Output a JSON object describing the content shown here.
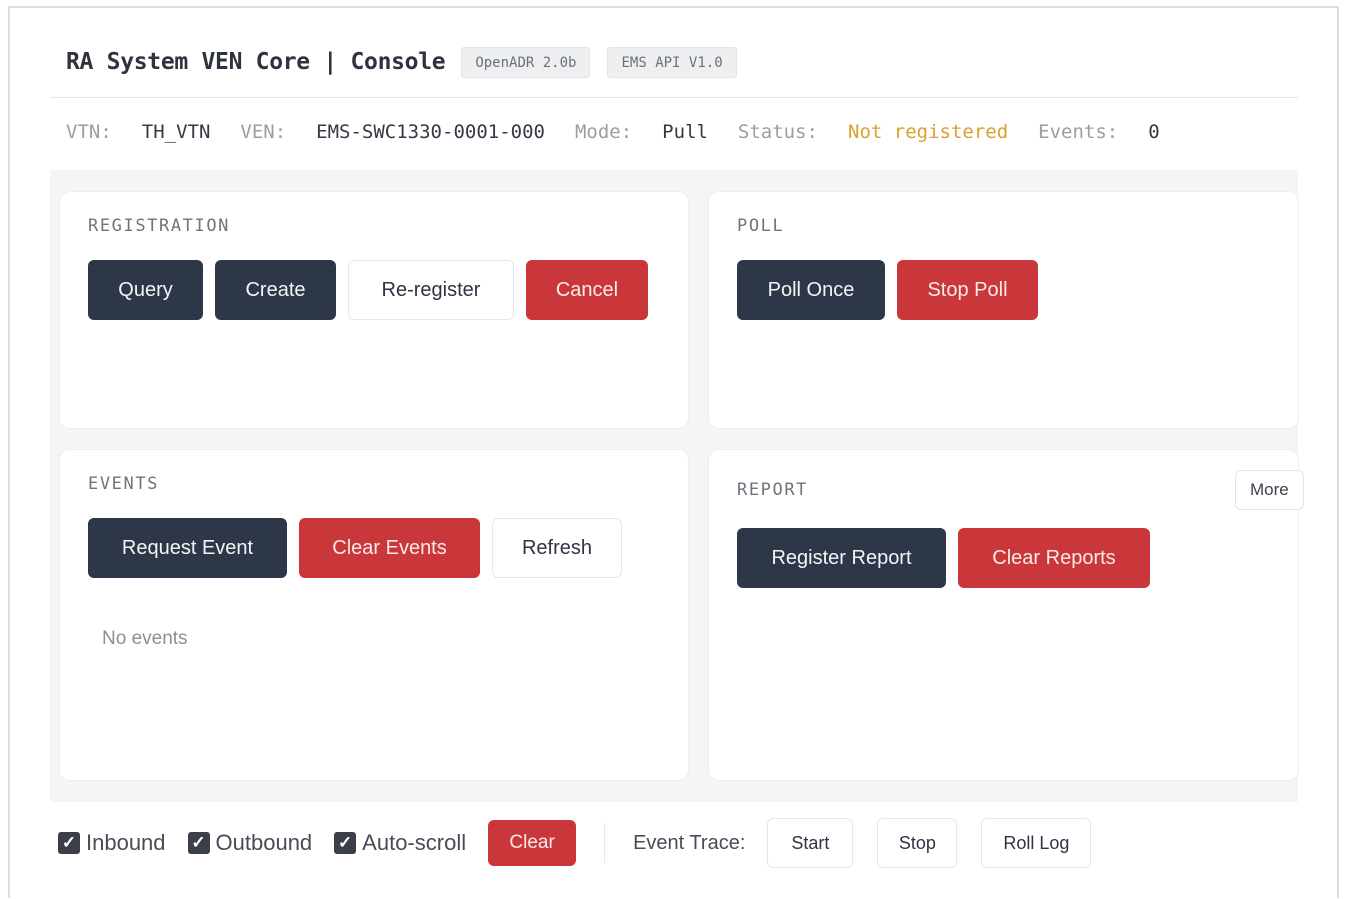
{
  "header": {
    "title": "RA System VEN Core | Console",
    "badges": [
      "OpenADR 2.0b",
      "EMS API V1.0"
    ]
  },
  "status": {
    "vtn_label": "VTN:",
    "vtn_value": "TH_VTN",
    "ven_label": "VEN:",
    "ven_value": "EMS-SWC1330-0001-000",
    "mode_label": "Mode:",
    "mode_value": "Pull",
    "status_label": "Status:",
    "status_value": "Not registered",
    "events_label": "Events:",
    "events_value": "0",
    "warn_color": "#d9a030"
  },
  "registration": {
    "label": "REGISTRATION",
    "buttons": [
      "Query",
      "Create",
      "Re-register",
      "Cancel"
    ]
  },
  "poll": {
    "label": "POLL",
    "buttons": [
      "Poll Once",
      "Stop Poll"
    ]
  },
  "events": {
    "label": "EVENTS",
    "buttons": [
      "Request Event",
      "Clear Events",
      "Refresh"
    ],
    "empty": "No events"
  },
  "report": {
    "label": "REPORT",
    "more": "More",
    "buttons": [
      "Register Report",
      "Clear Reports"
    ]
  },
  "footer": {
    "checks": [
      {
        "label": "Inbound",
        "checked": true
      },
      {
        "label": "Outbound",
        "checked": true
      },
      {
        "label": "Auto-scroll",
        "checked": true
      }
    ],
    "clear": "Clear",
    "trace_label": "Event Trace:",
    "trace_buttons": [
      "Start",
      "Stop",
      "Roll Log"
    ]
  },
  "colors": {
    "dark_button": "#2e3748",
    "danger_button": "#c9373a",
    "panel_bg": "#f4f5f7"
  }
}
